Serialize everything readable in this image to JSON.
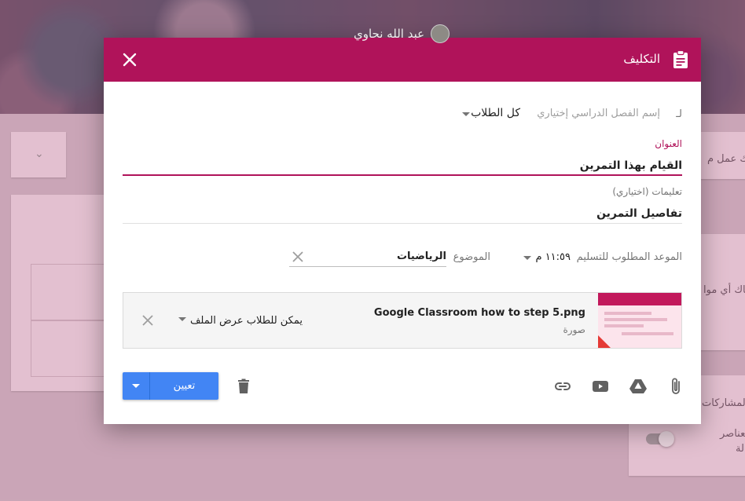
{
  "background": {
    "owner_name": "عبد الله نحاوي",
    "right_text_1": "ناك عمل م",
    "right_text_2": "ناك أي موا",
    "right_text_3": "المشاركات",
    "right_text_4": "العناصر",
    "right_text_5": "لة"
  },
  "dialog": {
    "title": "التكليف",
    "for_prefix": "لـ",
    "class_placeholder": "إسم الفصل الدراسي إختياري",
    "students_selector": "كل الطلاب",
    "title_label": "العنوان",
    "title_value": "القيام بهذا التمرين",
    "instructions_label": "تعليمات (اختياري)",
    "instructions_value": "تفاصيل التمرين",
    "due_label": "الموعد المطلوب للتسليم",
    "due_time": "١١:٥٩ م",
    "topic_label": "الموضوع",
    "topic_value": "الرياضيات",
    "attachment": {
      "name": "Google Classroom how to step 5.png",
      "type": "صورة",
      "share_option": "يمكن للطلاب عرض الملف"
    },
    "assign_label": "تعيين"
  },
  "colors": {
    "accent": "#b0135a",
    "button": "#4285f4"
  }
}
